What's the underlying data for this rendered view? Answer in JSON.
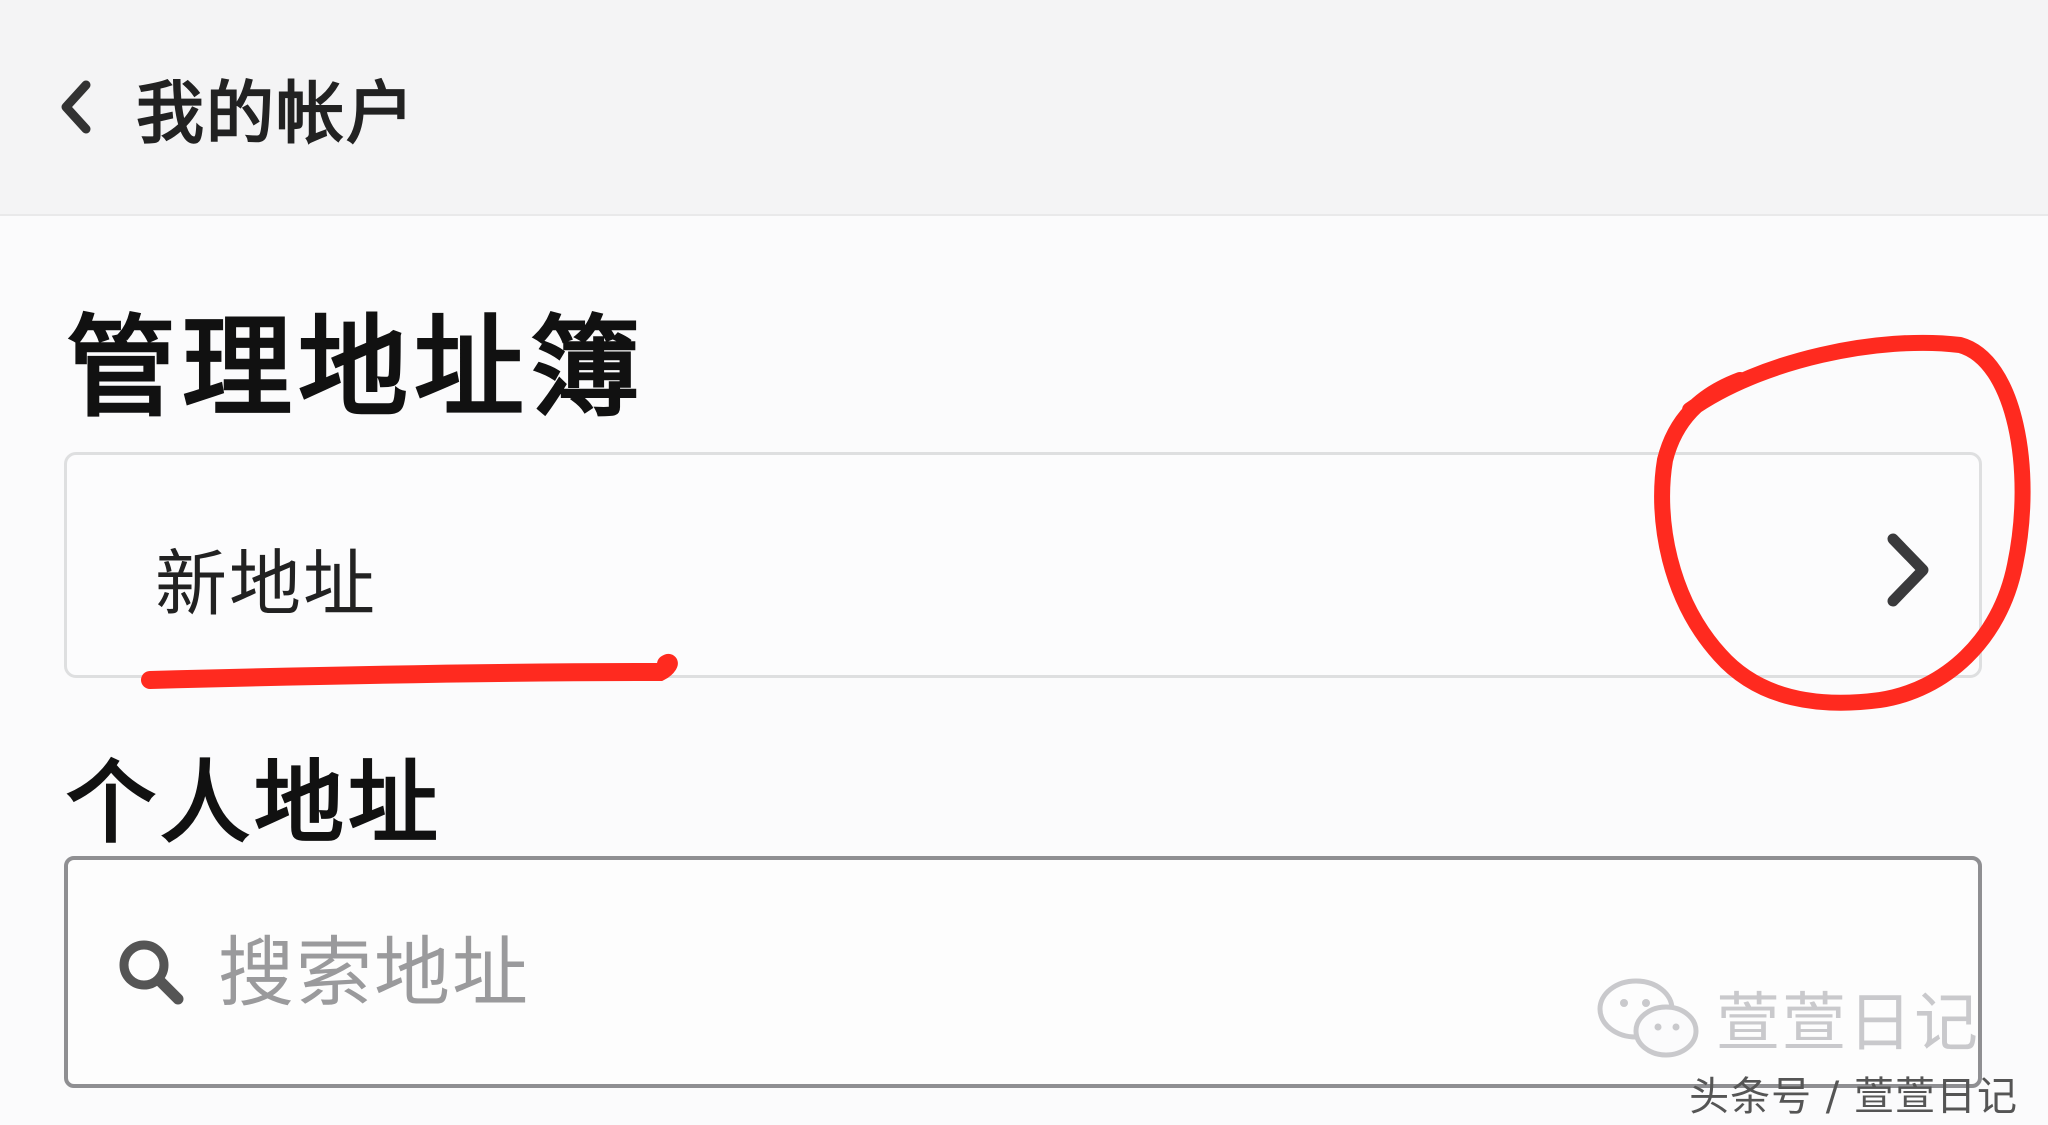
{
  "header": {
    "back_label": "我的帐户"
  },
  "page": {
    "title": "管理地址簿"
  },
  "new_address": {
    "label": "新地址"
  },
  "personal": {
    "section_title": "个人地址",
    "search_placeholder": "搜索地址"
  },
  "watermark": {
    "brand": "萱萱日记",
    "source": "头条号 / 萱萱日记"
  },
  "colors": {
    "annotation_red": "#ff2a1f",
    "header_bg": "#f4f4f5"
  },
  "icons": {
    "back": "chevron-left-icon",
    "row_arrow": "chevron-right-icon",
    "search": "search-icon",
    "wechat": "wechat-icon"
  }
}
